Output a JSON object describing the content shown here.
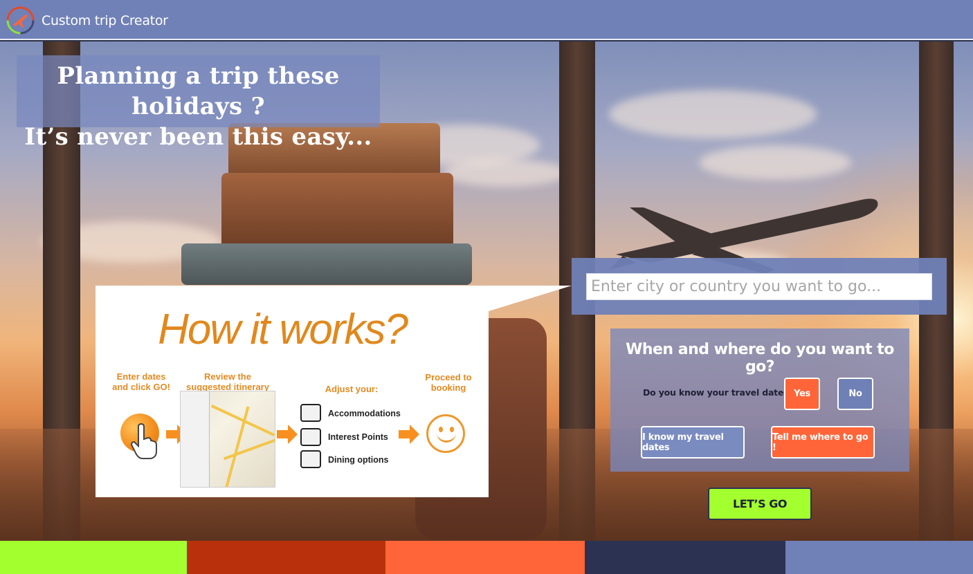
{
  "header": {
    "brand": "Custom trip Creator",
    "bg_color": "#7081b7"
  },
  "headline": {
    "line1": "Planning a trip these holidays ?",
    "line2": "It’s never been this easy..."
  },
  "how_it_works": {
    "title": "How it works?",
    "step1": [
      "Enter dates",
      "and click GO!"
    ],
    "step2": [
      "Review the",
      "suggested itinerary"
    ],
    "step3_title": "Adjust your:",
    "step3_items": [
      "Accommodations",
      "Interest Points",
      "Dining options"
    ],
    "step4": [
      "Proceed to",
      "booking"
    ],
    "accent_color": "#e1881d"
  },
  "search": {
    "placeholder": "Enter city or country you want to go..."
  },
  "when_where": {
    "title": "When and where do you want to go?",
    "question": "Do you know your travel dates?",
    "yes_label": "Yes",
    "no_label": "No",
    "know_dates_label": "I know my travel dates",
    "tell_me_label": "Tell me where to go !"
  },
  "go_button": {
    "label": "LET’S GO",
    "color": "#a3ff2e"
  },
  "footer": {
    "colors": [
      "#a3ff2e",
      "#b8310c",
      "#ff6539",
      "#2c3252",
      "#7081b7"
    ]
  }
}
